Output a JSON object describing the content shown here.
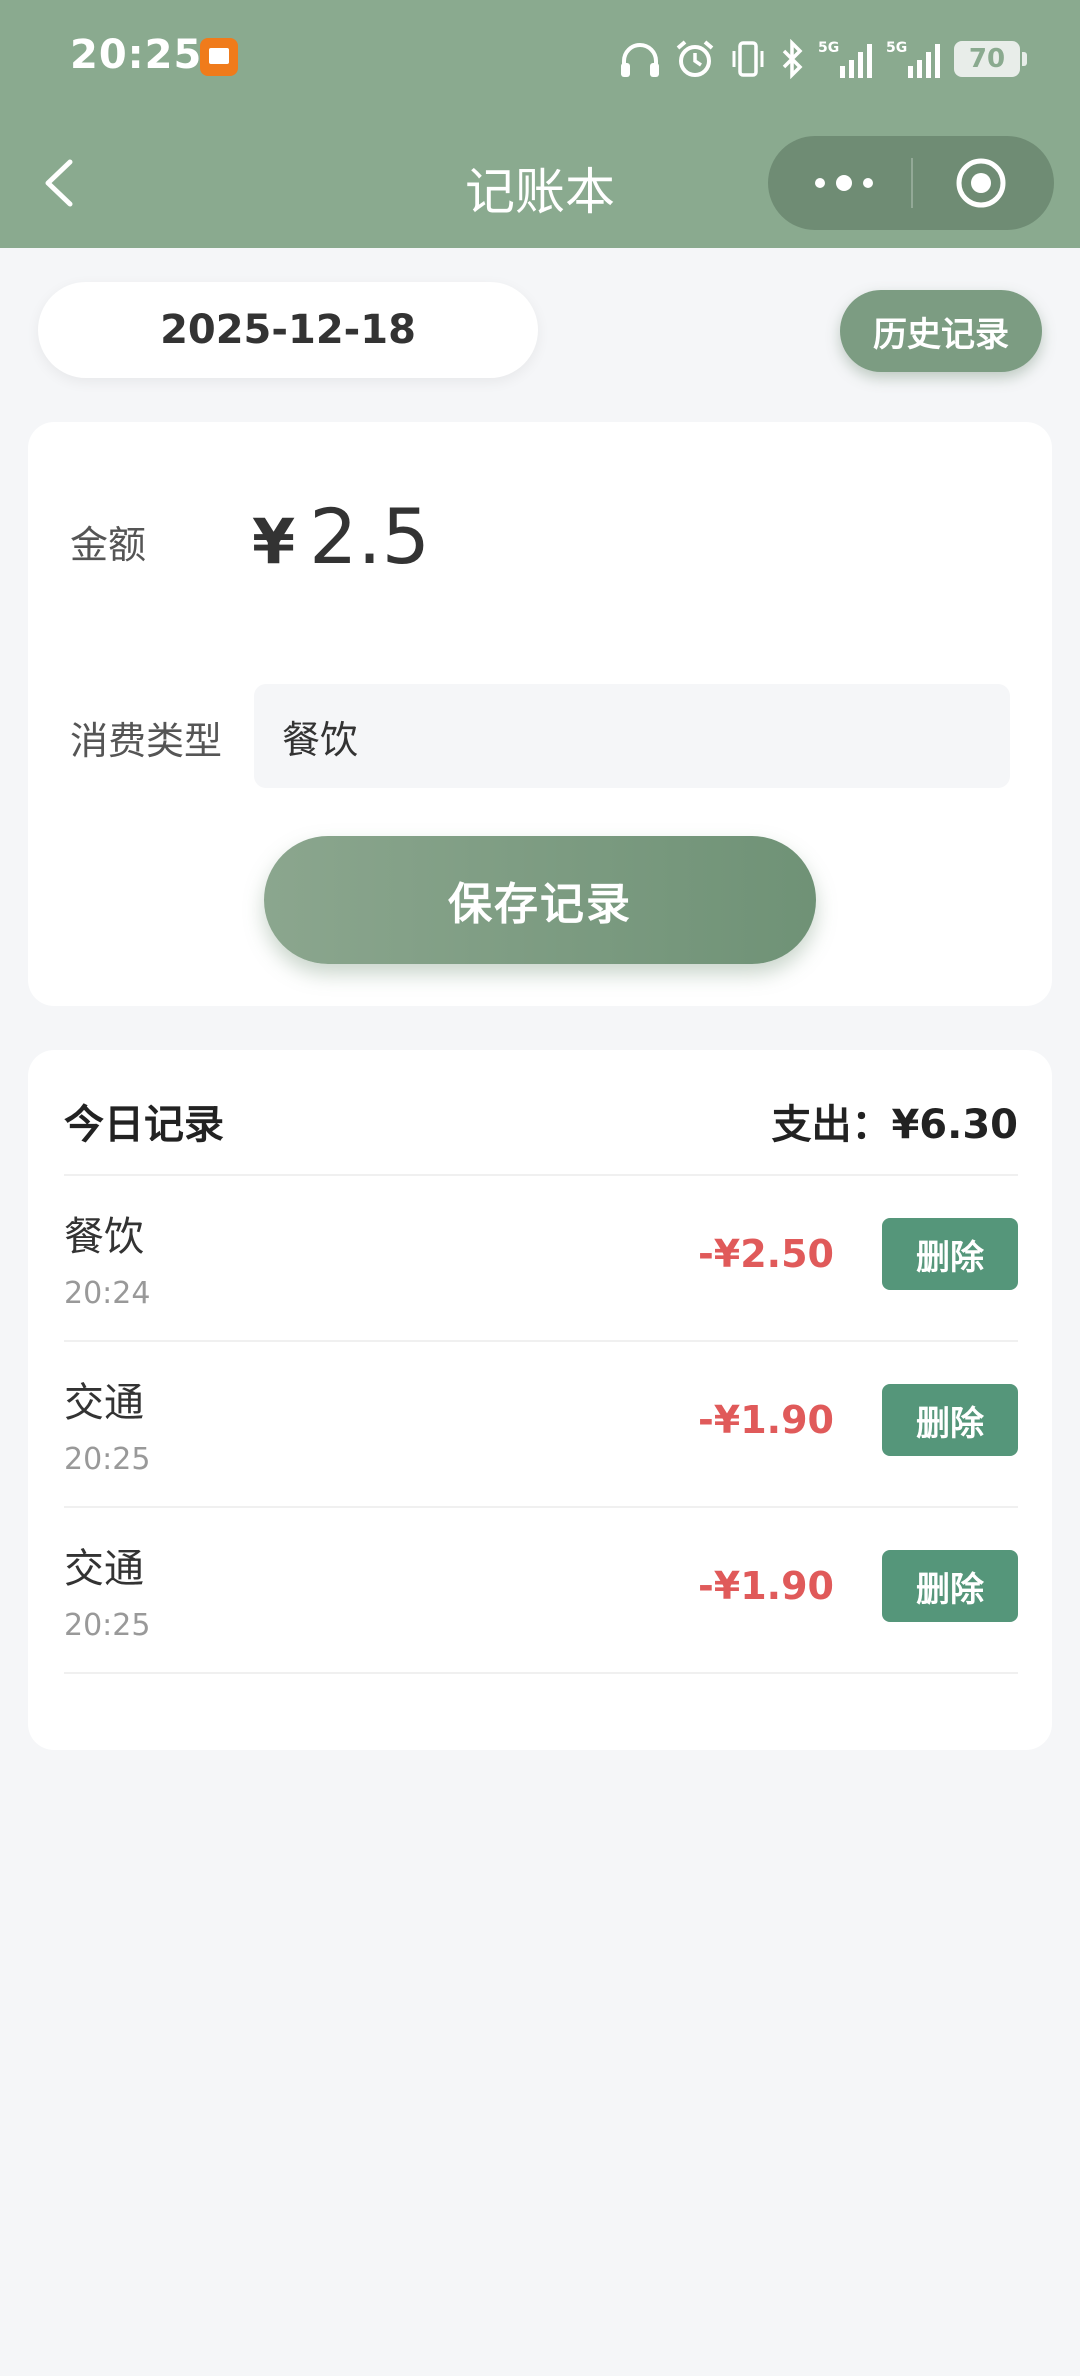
{
  "status_bar": {
    "time": "20:25",
    "battery": "70",
    "signal_label_1": "5G",
    "signal_label_2": "5G"
  },
  "nav": {
    "title": "记账本"
  },
  "date": {
    "value": "2025-12-18",
    "history_label": "历史记录"
  },
  "form": {
    "amount_label": "金额",
    "currency": "¥",
    "amount_value": "2.5",
    "type_label": "消费类型",
    "type_value": "餐饮",
    "save_label": "保存记录"
  },
  "today": {
    "title": "今日记录",
    "total": "支出：¥6.30",
    "delete_label": "删除",
    "records": [
      {
        "type": "餐饮",
        "time": "20:24",
        "amount": "-¥2.50"
      },
      {
        "type": "交通",
        "time": "20:25",
        "amount": "-¥1.90"
      },
      {
        "type": "交通",
        "time": "20:25",
        "amount": "-¥1.90"
      }
    ]
  },
  "colors": {
    "header_bg": "#8aaa8f",
    "accent": "#7c9c82",
    "delete_bg": "#55967a",
    "expense_text": "#e05a5a"
  }
}
